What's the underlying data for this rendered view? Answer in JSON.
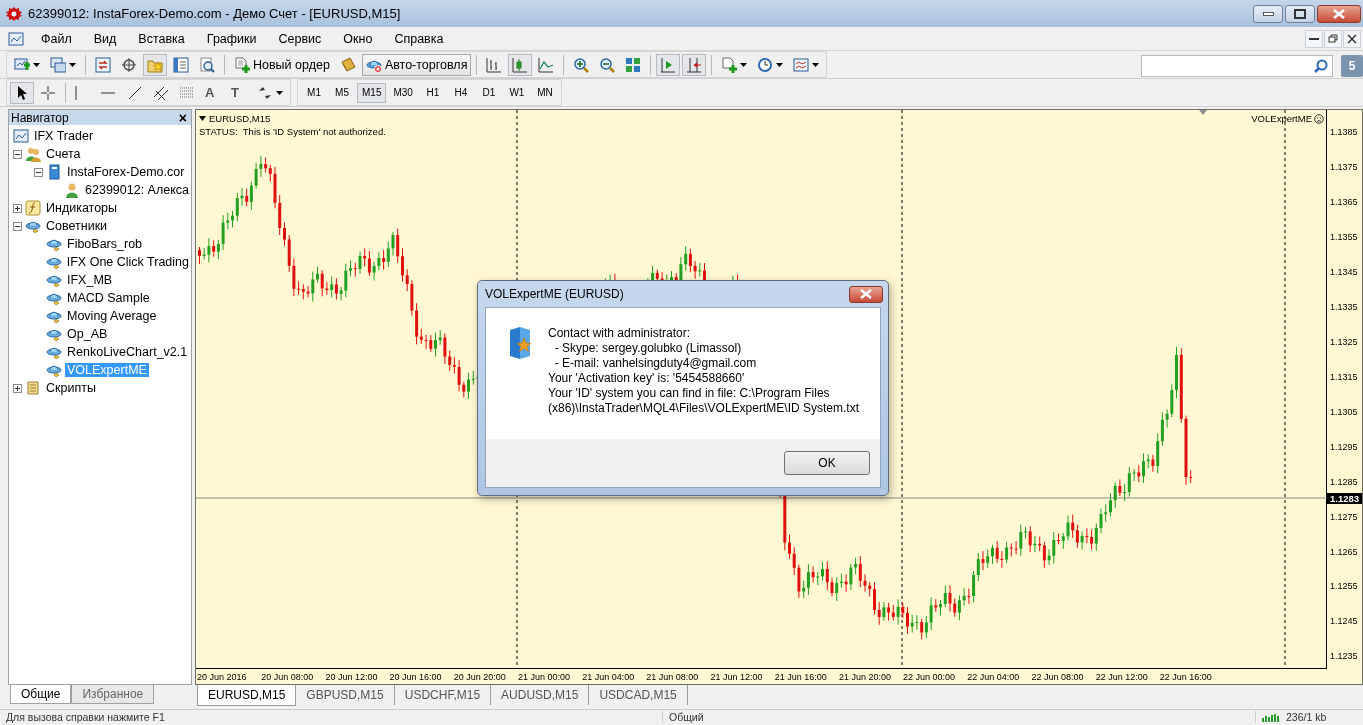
{
  "window": {
    "title": "62399012: InstaForex-Demo.com - Демо Счет - [EURUSD,M15]"
  },
  "menu": {
    "items": [
      {
        "label": "Файл"
      },
      {
        "label": "Вид"
      },
      {
        "label": "Вставка"
      },
      {
        "label": "Графики"
      },
      {
        "label": "Сервис"
      },
      {
        "label": "Окно"
      },
      {
        "label": "Справка"
      }
    ]
  },
  "toolbar": {
    "buttons": [
      {
        "kind": "new-chart",
        "pressed": false,
        "dropdown": true
      },
      {
        "kind": "profiles",
        "pressed": false,
        "dropdown": true
      },
      {
        "kind": "separator"
      },
      {
        "kind": "market-watch",
        "pressed": false
      },
      {
        "kind": "data-window",
        "pressed": false
      },
      {
        "kind": "navigator",
        "pressed": true
      },
      {
        "kind": "terminal",
        "pressed": false
      },
      {
        "kind": "tester",
        "pressed": false
      },
      {
        "kind": "separator"
      },
      {
        "kind": "new-order",
        "pressed": false,
        "label": "Новый ордер"
      },
      {
        "kind": "editor",
        "pressed": false
      },
      {
        "kind": "autotrading",
        "pressed": true,
        "label": "Авто-торговля"
      },
      {
        "kind": "separator"
      },
      {
        "kind": "bar-chart",
        "pressed": false
      },
      {
        "kind": "candles",
        "pressed": true
      },
      {
        "kind": "line-chart",
        "pressed": false
      },
      {
        "kind": "separator"
      },
      {
        "kind": "zoom-in",
        "pressed": false
      },
      {
        "kind": "zoom-out",
        "pressed": false
      },
      {
        "kind": "tile",
        "pressed": false
      },
      {
        "kind": "separator"
      },
      {
        "kind": "autoscroll",
        "pressed": true
      },
      {
        "kind": "chart-shift",
        "pressed": true
      },
      {
        "kind": "separator"
      },
      {
        "kind": "indicators",
        "pressed": false,
        "dropdown": true
      },
      {
        "kind": "periods",
        "pressed": false,
        "dropdown": true
      },
      {
        "kind": "templates",
        "pressed": false,
        "dropdown": true
      }
    ]
  },
  "search": {
    "badge": "5"
  },
  "tools": {
    "buttons": [
      {
        "kind": "cursor",
        "pressed": true
      },
      {
        "kind": "crosshair",
        "pressed": false
      },
      {
        "kind": "separator"
      },
      {
        "kind": "vline",
        "pressed": false
      },
      {
        "kind": "hline",
        "pressed": false
      },
      {
        "kind": "trendline",
        "pressed": false
      },
      {
        "kind": "channel",
        "pressed": false
      },
      {
        "kind": "fibo",
        "pressed": false
      },
      {
        "kind": "text",
        "pressed": false,
        "label": "A"
      },
      {
        "kind": "label",
        "pressed": false,
        "label": "T"
      },
      {
        "kind": "arrows",
        "pressed": false,
        "dropdown": true
      }
    ]
  },
  "timeframes": [
    {
      "label": "M1",
      "selected": false
    },
    {
      "label": "M5",
      "selected": false
    },
    {
      "label": "M15",
      "selected": true
    },
    {
      "label": "M30",
      "selected": false
    },
    {
      "label": "H1",
      "selected": false
    },
    {
      "label": "H4",
      "selected": false
    },
    {
      "label": "D1",
      "selected": false
    },
    {
      "label": "W1",
      "selected": false
    },
    {
      "label": "MN",
      "selected": false
    }
  ],
  "navigator": {
    "title": "Навигатор",
    "close": "×",
    "tree": [
      {
        "label": "IFX Trader",
        "kind": "root",
        "selected": false,
        "children": [
          {
            "label": "Счета",
            "kind": "accounts",
            "expanded": true,
            "selected": false,
            "children": [
              {
                "label": "InstaForex-Demo.cor",
                "kind": "server",
                "expanded": true,
                "selected": false,
                "children": [
                  {
                    "label": "62399012: Алекса",
                    "kind": "user",
                    "selected": false
                  }
                ]
              }
            ]
          },
          {
            "label": "Индикаторы",
            "kind": "indicators",
            "expanded": false,
            "selected": false
          },
          {
            "label": "Советники",
            "kind": "experts",
            "expanded": true,
            "selected": false,
            "children": [
              {
                "label": "FiboBars_rob",
                "kind": "expert",
                "selected": false
              },
              {
                "label": "IFX One Click Trading",
                "kind": "expert",
                "selected": false
              },
              {
                "label": "IFX_MB",
                "kind": "expert",
                "selected": false
              },
              {
                "label": "MACD Sample",
                "kind": "expert",
                "selected": false
              },
              {
                "label": "Moving Average",
                "kind": "expert",
                "selected": false
              },
              {
                "label": "Op_AB",
                "kind": "expert",
                "selected": false
              },
              {
                "label": "RenkoLiveChart_v2.1",
                "kind": "expert",
                "selected": false
              },
              {
                "label": "VOLExpertME",
                "kind": "expert",
                "selected": true
              }
            ]
          },
          {
            "label": "Скрипты",
            "kind": "scripts",
            "expanded": false,
            "selected": false
          }
        ]
      }
    ],
    "tabs": [
      {
        "label": "Общие",
        "selected": true
      },
      {
        "label": "Избранное",
        "selected": false
      }
    ]
  },
  "chart": {
    "symbol": "EURUSD,M15",
    "status": "STATUS:  This is 'ID System' not authorized.",
    "expert": "VOLExpertME",
    "price_labels": [
      "1.1385",
      "1.1375",
      "1.1365",
      "1.1355",
      "1.1345",
      "1.1335",
      "1.1325",
      "1.1315",
      "1.1305",
      "1.1295",
      "1.1285",
      "1.1275",
      "1.1265",
      "1.1255",
      "1.1245",
      "1.1235"
    ],
    "current_price": "1.1283",
    "time_labels": [
      "20 Jun 2016",
      "20 Jun 08:00",
      "20 Jun 12:00",
      "20 Jun 16:00",
      "20 Jun 20:00",
      "21 Jun 00:00",
      "21 Jun 04:00",
      "21 Jun 08:00",
      "21 Jun 12:00",
      "21 Jun 16:00",
      "21 Jun 20:00",
      "22 Jun 00:00",
      "22 Jun 04:00",
      "22 Jun 08:00",
      "22 Jun 12:00",
      "22 Jun 16:00"
    ]
  },
  "chart_tabs": [
    {
      "label": "EURUSD,M15",
      "selected": true
    },
    {
      "label": "GBPUSD,M15",
      "selected": false
    },
    {
      "label": "USDCHF,M15",
      "selected": false
    },
    {
      "label": "AUDUSD,M15",
      "selected": false
    },
    {
      "label": "USDCAD,M15",
      "selected": false
    }
  ],
  "dialog": {
    "title": "VOLExpertME (EURUSD)",
    "lines": [
      "Contact with administrator:",
      "  - Skype: sergey.golubko (Limassol)",
      "  - E-mail: vanhelsingduty4@gmail.com",
      "Your 'Activation key' is: '5454588660'",
      "Your 'ID' system you can find in file: C:\\Program Files",
      "(x86)\\InstaTrader\\MQL4\\Files\\VOLExpertME\\ID System.txt"
    ],
    "button": "OK"
  },
  "status_bar": {
    "help": "Для вызова справки нажмите F1",
    "profile": "Общий",
    "traffic": "236/1 kb"
  }
}
